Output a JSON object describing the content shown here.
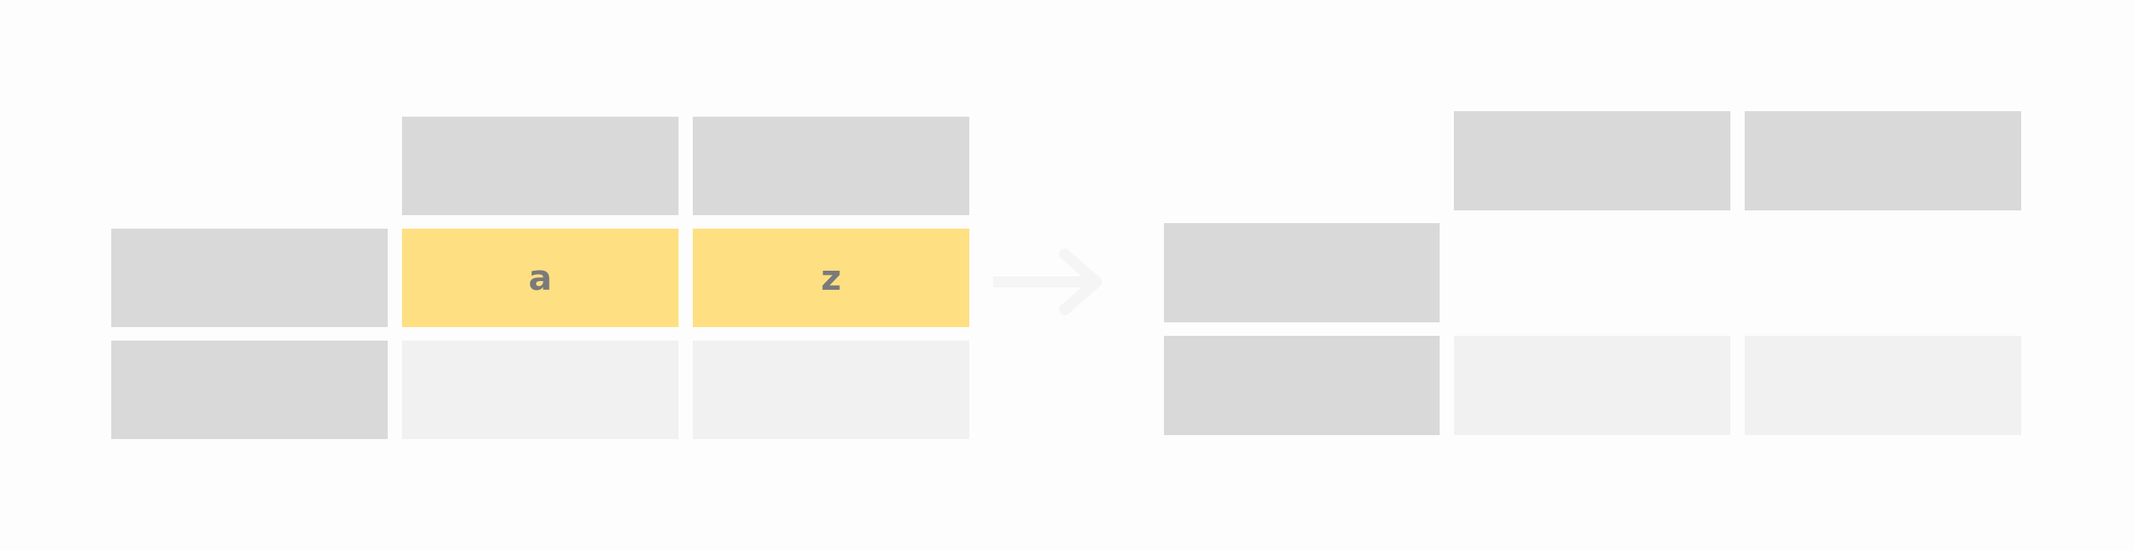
{
  "left_table": {
    "columns": [
      "",
      ""
    ],
    "rows": [
      {
        "header": "",
        "cells": [
          "a",
          "z"
        ],
        "highlighted": true
      },
      {
        "header": "",
        "cells": [
          "",
          ""
        ],
        "highlighted": false
      }
    ]
  },
  "right_table": {
    "columns": [
      "",
      ""
    ],
    "rows": [
      {
        "header": "",
        "cells": [
          "",
          ""
        ],
        "removed": true
      },
      {
        "header": "",
        "cells": [
          "",
          ""
        ],
        "removed": false
      }
    ]
  },
  "colors": {
    "header": "#d9d9d9",
    "highlight": "#fedf82",
    "empty": "#f1f1f1",
    "text": "#7a7a7a",
    "background": "#fdfdfd"
  }
}
